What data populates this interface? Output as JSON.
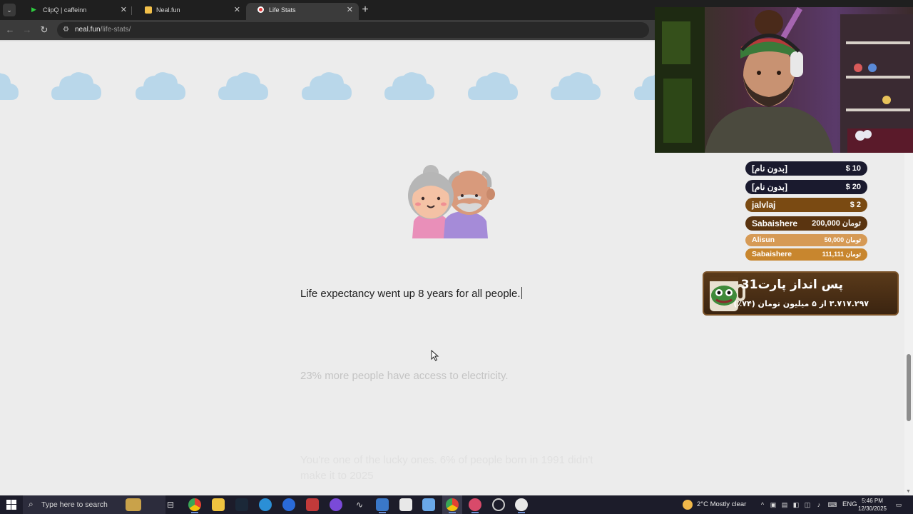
{
  "browser": {
    "tabs": [
      {
        "title": "ClipQ | caffeinn",
        "active": false
      },
      {
        "title": "Neal.fun",
        "active": false
      },
      {
        "title": "Life Stats",
        "active": true
      }
    ],
    "url_host": "neal.fun",
    "url_path": "/life-stats/"
  },
  "page": {
    "stats": [
      "Life expectancy went up 8 years for all people.",
      "23% more people have access to electricity.",
      "You're one of the lucky ones. 6% of people born in 1991 didn't make it to 2025"
    ]
  },
  "overlay": {
    "donations": [
      {
        "name": "[بدون نام]",
        "amount": "$ 10",
        "color": "#1a1a2e"
      },
      {
        "name": "[بدون نام]",
        "amount": "$ 20",
        "color": "#1a1a2e"
      },
      {
        "name": "jalvlaj",
        "amount": "$ 2",
        "color": "#7a4a12"
      },
      {
        "name": "Sabaishere",
        "amount": "200,000 تومان",
        "color": "#5a3410"
      },
      {
        "name": "Alisun",
        "amount": "50,000 تومان",
        "color": "#d69a55"
      },
      {
        "name": "Sabaishere",
        "amount": "111,111 تومان",
        "color": "#c8862e"
      }
    ],
    "goal": {
      "title": "پس انداز پارت31",
      "progress": "۳.۷۱۷.۲۹۷ از ۵ میلیون تومان (۷۴٪)"
    }
  },
  "taskbar": {
    "search_placeholder": "Type here to search",
    "weather": "2°C  Mostly clear",
    "language": "ENG",
    "time": "5:46 PM",
    "date": "12/30/2025"
  }
}
